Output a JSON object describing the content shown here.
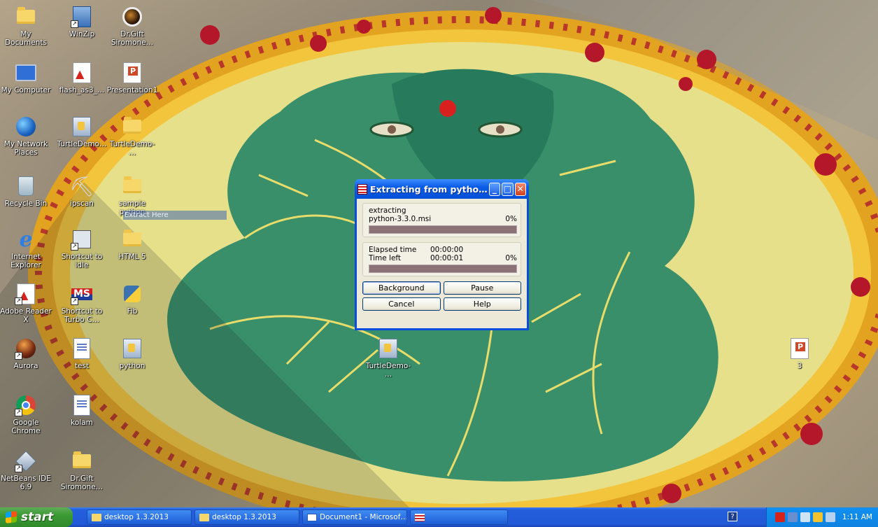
{
  "desktop": {
    "icons": [
      {
        "label": "My Documents"
      },
      {
        "label": "WinZip"
      },
      {
        "label": "Dr.Gift Siromone…"
      },
      {
        "label": "My Computer"
      },
      {
        "label": "flash_as3_…"
      },
      {
        "label": "Presentation1"
      },
      {
        "label": "My Network Places"
      },
      {
        "label": "TurtleDemo…"
      },
      {
        "label": "TurtleDemo-…"
      },
      {
        "label": "Recycle Bin"
      },
      {
        "label": "ipscan"
      },
      {
        "label": "sample python"
      },
      {
        "label": "Internet Explorer"
      },
      {
        "label": "Shortcut to idle"
      },
      {
        "label": "HTML 5"
      },
      {
        "label": "Adobe Reader X"
      },
      {
        "label": "Shortcut to Turbo C…"
      },
      {
        "label": "Fib"
      },
      {
        "label": "Aurora"
      },
      {
        "label": "test"
      },
      {
        "label": "python"
      },
      {
        "label": "TurtleDemo-…"
      },
      {
        "label": "3"
      },
      {
        "label": "Google Chrome"
      },
      {
        "label": "kolam"
      },
      {
        "label": "NetBeans IDE 6.9"
      },
      {
        "label": "Dr.Gift Siromone…"
      }
    ],
    "drag_hint": "Extract Here"
  },
  "dialog": {
    "title": "Extracting from pytho…",
    "status_label": "extracting",
    "file_name": "python-3.3.0.msi",
    "file_progress_text": "0%",
    "file_progress": 0,
    "elapsed_label": "Elapsed time",
    "elapsed_value": "00:00:00",
    "left_label": "Time left",
    "left_value": "00:00:01",
    "total_progress_text": "0%",
    "total_progress": 0,
    "buttons": {
      "background": "Background",
      "pause": "Pause",
      "cancel": "Cancel",
      "help": "Help"
    }
  },
  "taskbar": {
    "start_label": "start",
    "buttons": [
      {
        "label": "desktop 1.3.2013",
        "icon": "folder-icon"
      },
      {
        "label": "desktop 1.3.2013",
        "icon": "folder-icon"
      },
      {
        "label": "Document1 - Microsof…",
        "icon": "word-icon"
      },
      {
        "label": "",
        "icon": "winrar-icon"
      }
    ],
    "clock": "1:11 AM",
    "help_glyph": "?"
  },
  "colors": {
    "title_blue": "#0450d6",
    "start_green": "#3c9a34",
    "progress_track": "#8b7277"
  }
}
